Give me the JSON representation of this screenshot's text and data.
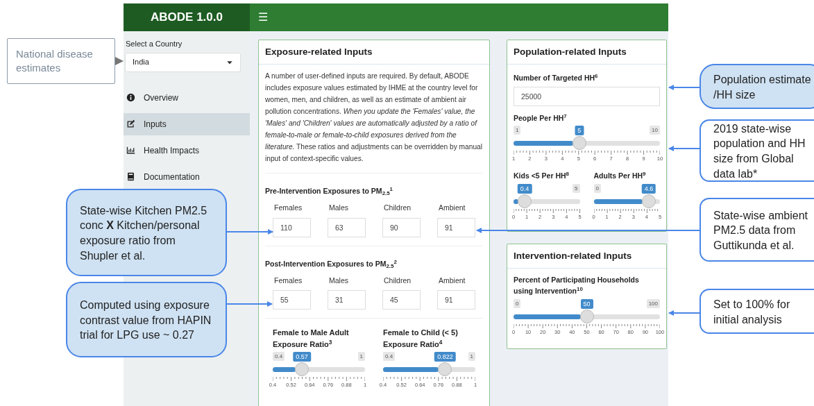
{
  "app": {
    "title": "ABODE 1.0.0",
    "menu_glyph": "☰"
  },
  "sidebar": {
    "country_label": "Select a Country",
    "country": {
      "value": "India"
    },
    "items": [
      {
        "label": "Overview",
        "kind": "info",
        "selected": false
      },
      {
        "label": "Inputs",
        "kind": "edit",
        "selected": true
      },
      {
        "label": "Health Impacts",
        "kind": "chart",
        "selected": false
      },
      {
        "label": "Documentation",
        "kind": "book",
        "selected": false
      }
    ]
  },
  "exposure_panel": {
    "title": "Exposure-related Inputs",
    "intro": "A number of user-defined inputs are required. By default, ABODE includes exposure values estimated by IHME at the country level for women, men, and children, as well as an estimate of ambient air pollution concentrations. *When you update the 'Females' value, the 'Males' and 'Children' values are automatically adjusted by a ratio of female-to-male or female-to-child exposures derived from the literature.* These ratios and adjustments can be overridden by manual input of context-specific values.",
    "groups": [
      {
        "title": "Pre-Intervention Exposures to PM$_{2.5}$$^{1}$",
        "fields": [
          {
            "label": "Females",
            "value": "110"
          },
          {
            "label": "Males",
            "value": "63"
          },
          {
            "label": "Children",
            "value": "90"
          },
          {
            "label": "Ambient",
            "value": "91"
          }
        ]
      },
      {
        "title": "Post-Intervention Exposures to PM$_{2.5}$$^{2}$",
        "fields": [
          {
            "label": "Females",
            "value": "55"
          },
          {
            "label": "Males",
            "value": "31"
          },
          {
            "label": "Children",
            "value": "45"
          },
          {
            "label": "Ambient",
            "value": "91"
          }
        ]
      }
    ],
    "ratio_sliders": [
      {
        "label": "Female to Male Adult Exposure Ratio$^{3}$",
        "min": "0.4",
        "max": "1",
        "value": "0.57",
        "level": 0.283,
        "ticks": [
          "0.4",
          "0.52",
          "0.64",
          "0.76",
          "0.88",
          "1"
        ]
      },
      {
        "label": "Female to Child (< 5) Exposure Ratio$^{4}$",
        "min": "0.4",
        "max": "1",
        "value": "0.822",
        "level": 0.703,
        "ticks": [
          "0.4",
          "0.52",
          "0.64",
          "0.76",
          "0.88",
          "1"
        ]
      }
    ]
  },
  "population_panel": {
    "title": "Population-related Inputs",
    "households": {
      "label": "Number of Targeted HH$^{6}$",
      "value": "25000"
    },
    "people_slider": {
      "label": "People Per HH$^{7}$",
      "min": "1",
      "max": "10",
      "value": "5",
      "level": 0.444,
      "ticks": [
        "1",
        "2",
        "3",
        "4",
        "5",
        "6",
        "7",
        "8",
        "9",
        "10"
      ]
    },
    "split_sliders": [
      {
        "label": "Kids <5 Per HH$^{8}$",
        "max": "5",
        "value": "0.4",
        "level": 0.08,
        "ticks": [
          "0",
          "1",
          "2",
          "3",
          "4",
          "5"
        ]
      },
      {
        "label": "Adults Per HH$^{9}$",
        "min": "0",
        "value": "4.6",
        "level": 0.92,
        "ticks": [
          "0",
          "1",
          "2",
          "3",
          "4",
          "5"
        ]
      }
    ]
  },
  "intervention_panel": {
    "title": "Intervention-related Inputs",
    "slider": {
      "label": "Percent of Participating Households using Intervention$^{10}$",
      "min": "0",
      "max": "100",
      "value": "50",
      "level": 0.5,
      "ticks": [
        "0",
        "10",
        "20",
        "30",
        "40",
        "50",
        "60",
        "70",
        "80",
        "90",
        "100"
      ]
    }
  },
  "callouts": [
    {
      "text": "National disease estimates",
      "kind": "plain"
    },
    {
      "text": "State-wise Kitchen PM2.5 conc **X** Kitchen/personal exposure ratio from Shupler et al.",
      "kind": "filled"
    },
    {
      "text": "Computed using exposure contrast value from HAPIN trial for LPG use ~ 0.27",
      "kind": "filled"
    },
    {
      "text": "Population estimate /HH size",
      "kind": "filled"
    },
    {
      "text": "2019 state-wise population and HH size from Global data lab*",
      "kind": "outline"
    },
    {
      "text": "State-wise ambient PM2.5 data from Guttikunda et al.",
      "kind": "outline"
    },
    {
      "text": "Set to 100% for initial analysis",
      "kind": "outline"
    }
  ]
}
